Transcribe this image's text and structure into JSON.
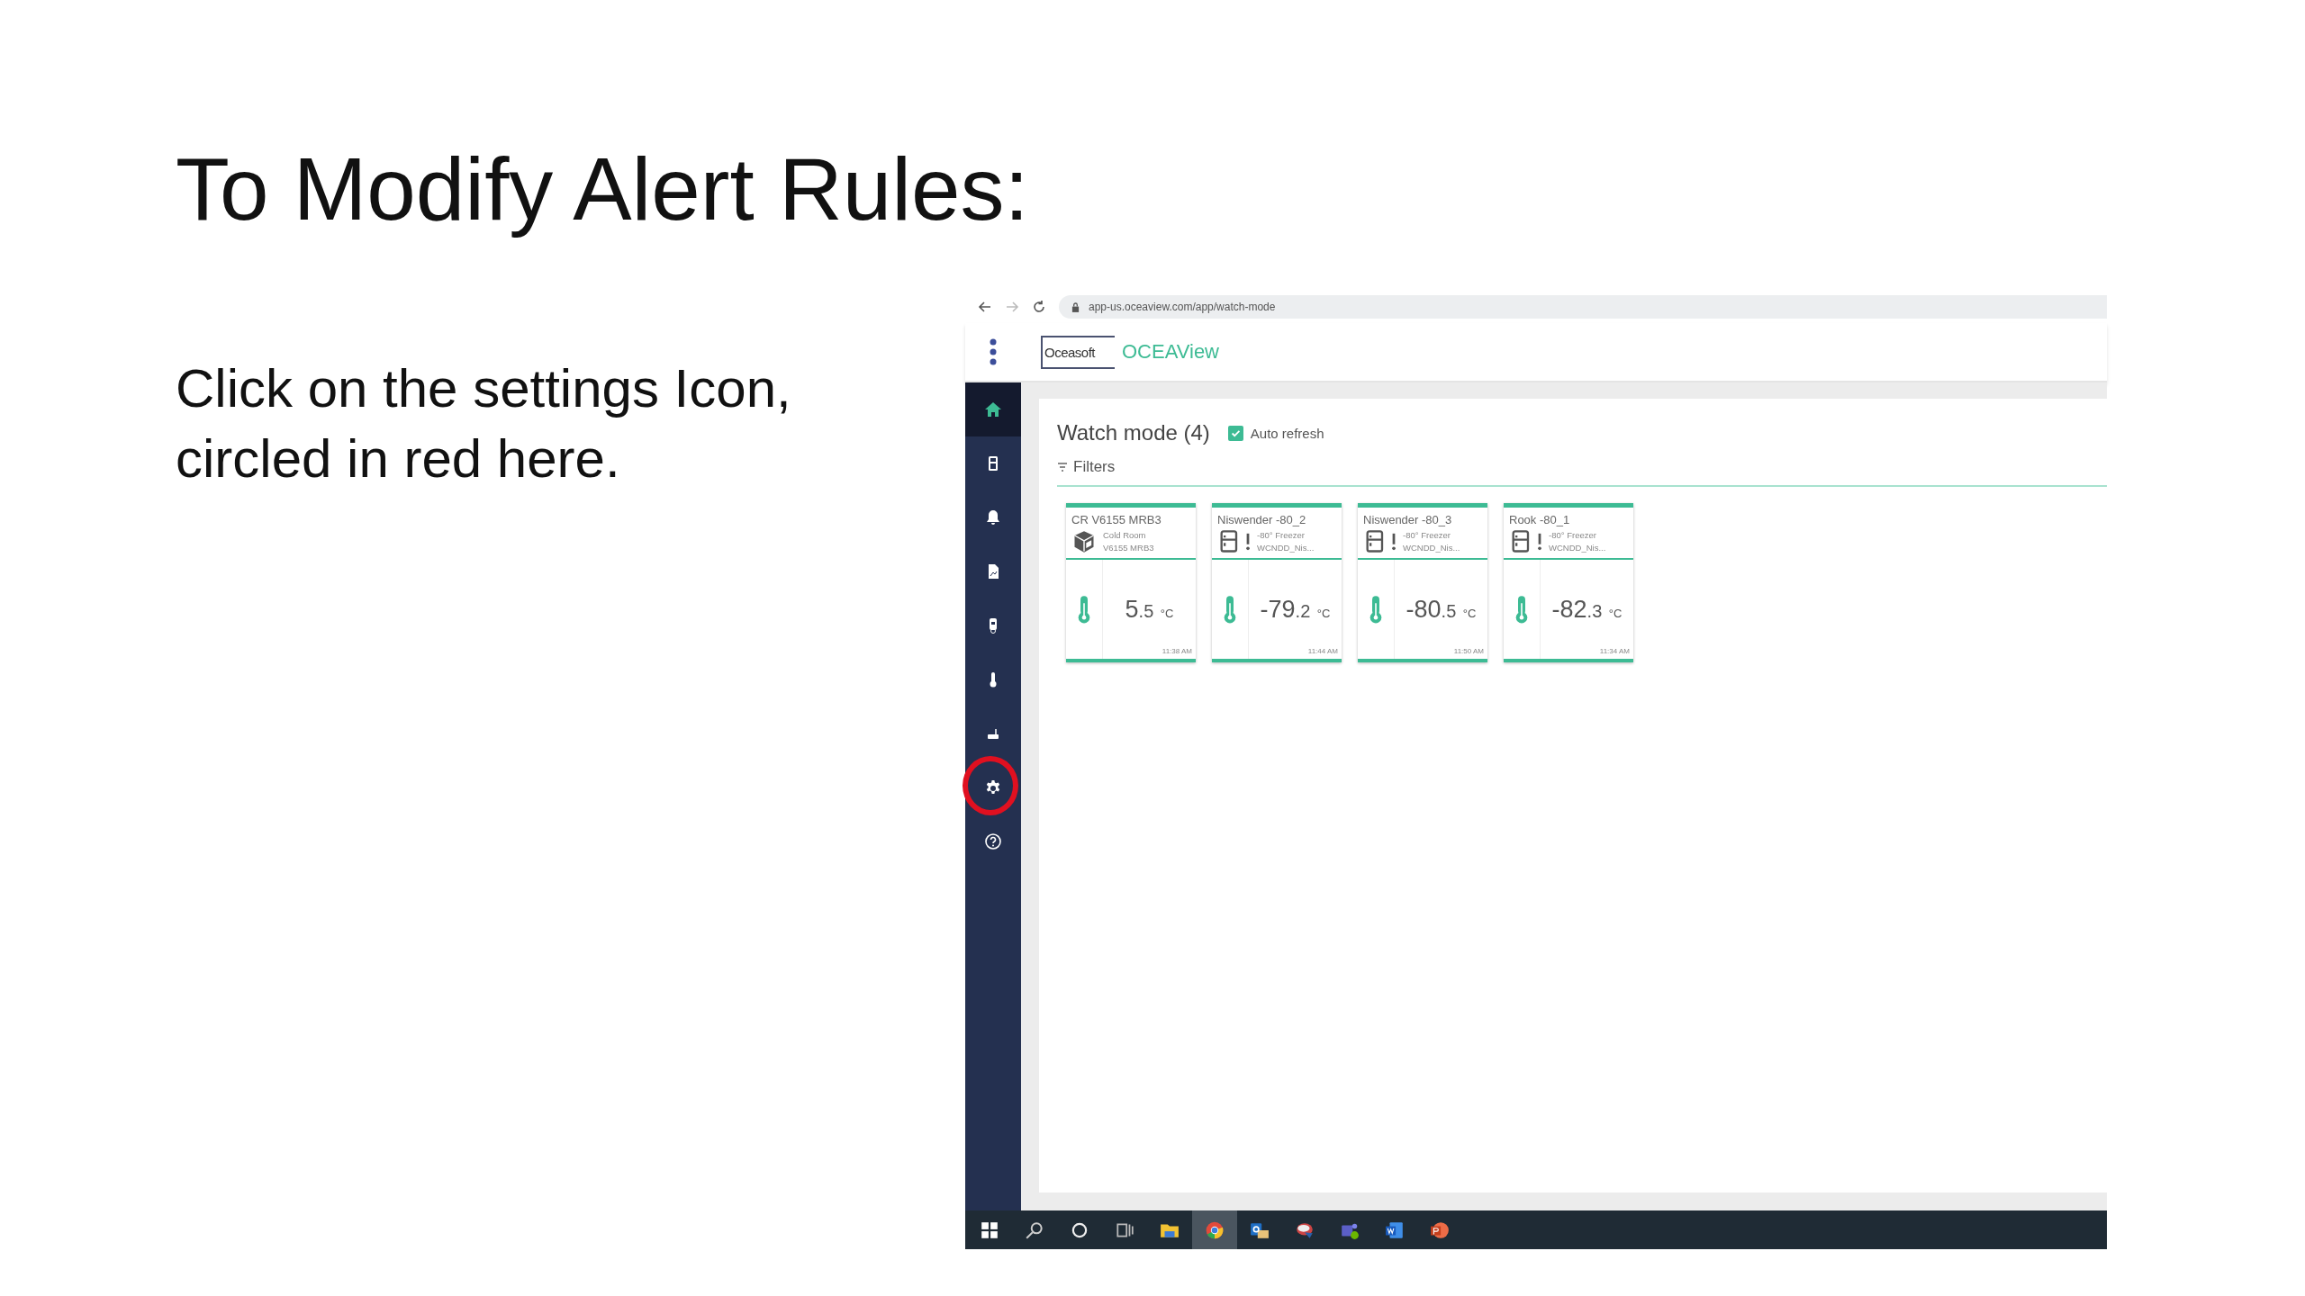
{
  "slide": {
    "title": "To Modify Alert Rules:",
    "body": "Click on the settings Icon, circled in red here."
  },
  "browser": {
    "url": "app-us.oceaview.com/app/watch-mode"
  },
  "app": {
    "logo": "Oceasoft",
    "name": "OCEAView"
  },
  "sidebar": {
    "items": [
      {
        "kind": "home",
        "selected": true,
        "circled": false
      },
      {
        "kind": "fridge",
        "selected": false,
        "circled": false
      },
      {
        "kind": "bell",
        "selected": false,
        "circled": false
      },
      {
        "kind": "report",
        "selected": false,
        "circled": false
      },
      {
        "kind": "sensor",
        "selected": false,
        "circled": false
      },
      {
        "kind": "thermometer",
        "selected": false,
        "circled": false
      },
      {
        "kind": "gateway",
        "selected": false,
        "circled": false
      },
      {
        "kind": "settings",
        "selected": false,
        "circled": true
      },
      {
        "kind": "help",
        "selected": false,
        "circled": false
      }
    ]
  },
  "watch": {
    "title": "Watch mode (4)",
    "auto_refresh": {
      "label": "Auto refresh",
      "checked": true
    },
    "filters": "Filters",
    "cards": [
      {
        "name": "CR V6155 MRB3",
        "kind": "cold-room",
        "alert": false,
        "line1": "Cold Room",
        "line2": "V6155 MRB3",
        "value": "5",
        "decimal": ".5",
        "unit": "°C",
        "time": "11:38 AM"
      },
      {
        "name": "Niswender -80_2",
        "kind": "freezer",
        "alert": true,
        "line1": "-80° Freezer",
        "line2": "WCNDD_Nis...",
        "value": "-79",
        "decimal": ".2",
        "unit": "°C",
        "time": "11:44 AM"
      },
      {
        "name": "Niswender -80_3",
        "kind": "freezer",
        "alert": true,
        "line1": "-80° Freezer",
        "line2": "WCNDD_Nis...",
        "value": "-80",
        "decimal": ".5",
        "unit": "°C",
        "time": "11:50 AM"
      },
      {
        "name": "Rook -80_1",
        "kind": "freezer",
        "alert": true,
        "line1": "-80° Freezer",
        "line2": "WCNDD_Nis...",
        "value": "-82",
        "decimal": ".3",
        "unit": "°C",
        "time": "11:34 AM"
      }
    ]
  },
  "taskbar": {
    "items": [
      {
        "kind": "windows",
        "selected": false
      },
      {
        "kind": "search",
        "selected": false
      },
      {
        "kind": "cortana",
        "selected": false
      },
      {
        "kind": "task-view",
        "selected": false
      },
      {
        "kind": "folder",
        "selected": false
      },
      {
        "kind": "chrome",
        "selected": true
      },
      {
        "kind": "outlook",
        "selected": false
      },
      {
        "kind": "app",
        "selected": false
      },
      {
        "kind": "teams",
        "selected": false
      },
      {
        "kind": "word",
        "selected": false
      },
      {
        "kind": "powerpoint",
        "selected": false
      }
    ]
  }
}
